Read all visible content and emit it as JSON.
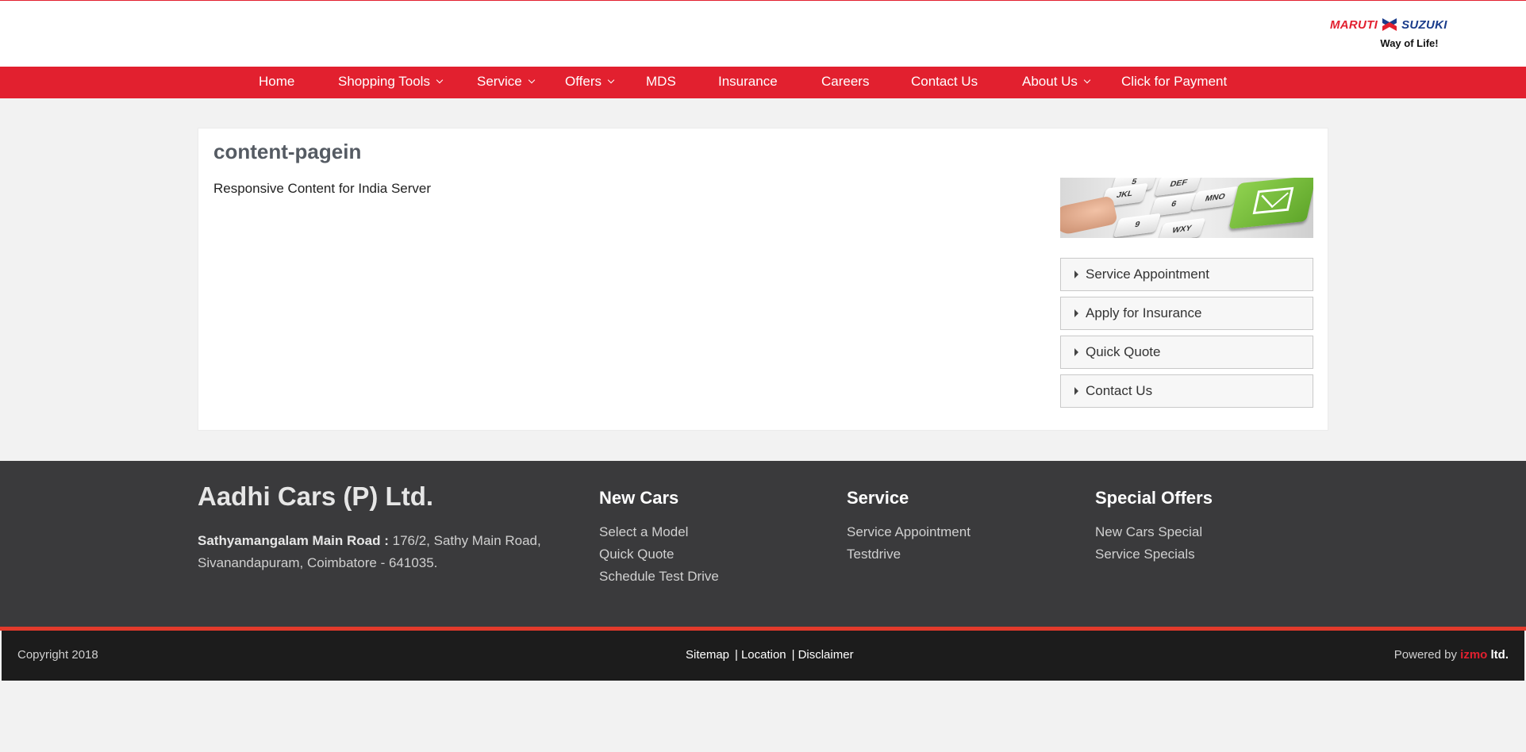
{
  "brand": {
    "logo_maruti": "MARUTI",
    "logo_suzuki": "SUZUKI",
    "tagline": "Way of Life!",
    "colors": {
      "primary_red": "#e2202f",
      "suzuki_blue": "#1a3c8b",
      "footer_dark": "#3a3a3c",
      "bottom_bar": "#1c1c1c"
    }
  },
  "nav": {
    "home": "Home",
    "shopping_tools": "Shopping Tools",
    "service": "Service",
    "offers": "Offers",
    "mds": "MDS",
    "insurance": "Insurance",
    "careers": "Careers",
    "contact_us": "Contact Us",
    "about_us": "About Us",
    "payment": "Click for Payment"
  },
  "content": {
    "title": "content-pagein",
    "text": "Responsive Content for India Server",
    "banner_keys": [
      "5",
      "JKL",
      "6",
      "MNO",
      "DEF",
      "9",
      "WXY"
    ]
  },
  "sidebar": {
    "items": [
      {
        "label": "Service Appointment"
      },
      {
        "label": "Apply for Insurance"
      },
      {
        "label": "Quick Quote"
      },
      {
        "label": "Contact Us"
      }
    ]
  },
  "footer": {
    "company": "Aadhi Cars (P) Ltd.",
    "address_label": "Sathyamangalam Main Road :",
    "address_line1": " 176/2, Sathy Main Road,",
    "address_line2": "Sivanandapuram, Coimbatore - 641035.",
    "new_cars": {
      "heading": "New Cars",
      "links": [
        "Select a Model",
        "Quick Quote",
        "Schedule Test Drive"
      ]
    },
    "service": {
      "heading": "Service",
      "links": [
        "Service Appointment",
        "Testdrive"
      ]
    },
    "special_offers": {
      "heading": "Special Offers",
      "links": [
        "New Cars Special",
        "Service Specials"
      ]
    }
  },
  "bottom": {
    "copyright": "Copyright 2018",
    "sitemap": "Sitemap",
    "location": "Location",
    "disclaimer": "Disclaimer",
    "separator": "|",
    "powered_by": "Powered by ",
    "izmo": "izmo",
    "ltd": " ltd."
  }
}
